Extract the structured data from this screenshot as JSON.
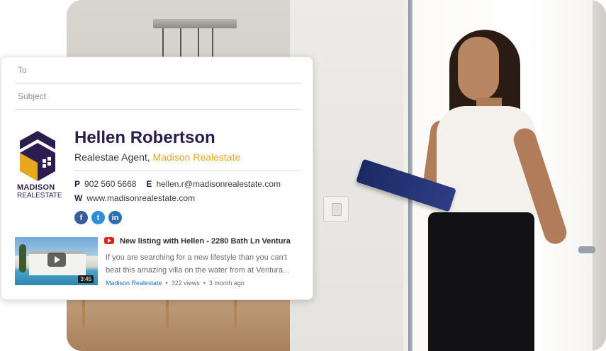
{
  "compose": {
    "to_placeholder": "To",
    "subject_placeholder": "Subject"
  },
  "logo": {
    "line1": "MADISON",
    "line2": "REALESTATE",
    "colors": {
      "primary": "#2b1d4e",
      "accent": "#e8a71e"
    }
  },
  "signature": {
    "name": "Hellen Robertson",
    "role": "Realestae Agent,",
    "company": "Madison Realestate",
    "phone_label": "P",
    "phone": "902 560 5668",
    "email_label": "E",
    "email": "hellen.r@madisonrealestate.com",
    "website_label": "W",
    "website": "www.madisonrealestate.com"
  },
  "socials": [
    {
      "name": "facebook-icon",
      "glyph": "f"
    },
    {
      "name": "twitter-icon",
      "glyph": "t"
    },
    {
      "name": "linkedin-icon",
      "glyph": "in"
    }
  ],
  "video": {
    "title": "New listing with Hellen - 2280 Bath Ln Ventura",
    "description": "If you are searching for a new lifestyle than you can't beat this amazing villa on the water from at Ventura...",
    "duration": "3:45",
    "channel": "Madison Realestate",
    "views": "322 views",
    "age": "3 month ago"
  }
}
